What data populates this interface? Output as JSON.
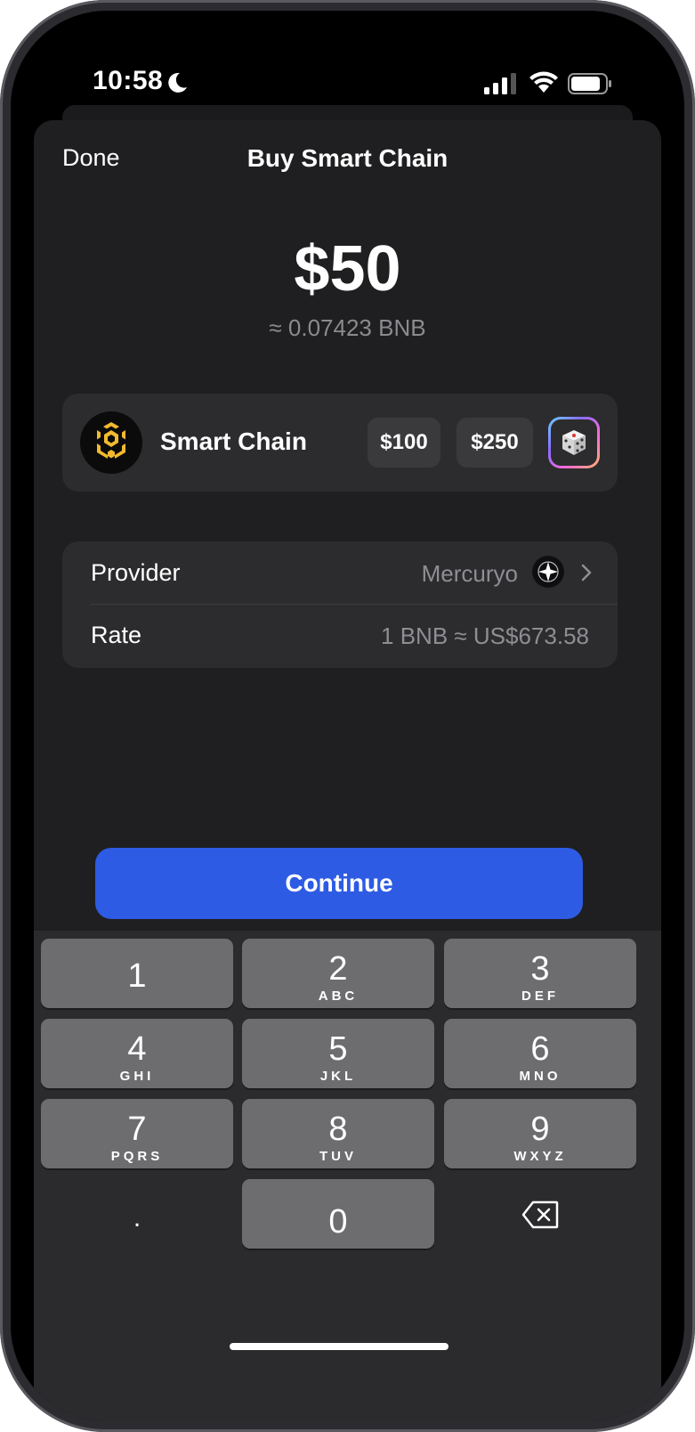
{
  "status_bar": {
    "time": "10:58"
  },
  "sheet": {
    "done_label": "Done",
    "title": "Buy Smart Chain"
  },
  "amount": {
    "value": "$50",
    "converted": "≈ 0.07423 BNB"
  },
  "asset": {
    "name": "Smart Chain",
    "logo_color": "#F3BA2F",
    "presets": [
      "$100",
      "$250"
    ],
    "random_icon": "dice-icon"
  },
  "details": {
    "provider_label": "Provider",
    "provider_value": "Mercuryo",
    "rate_label": "Rate",
    "rate_value": "1 BNB ≈ US$673.58"
  },
  "continue_label": "Continue",
  "accent_color": "#2D5BE3",
  "keypad": {
    "keys": [
      {
        "digit": "1",
        "letters": ""
      },
      {
        "digit": "2",
        "letters": "ABC"
      },
      {
        "digit": "3",
        "letters": "DEF"
      },
      {
        "digit": "4",
        "letters": "GHI"
      },
      {
        "digit": "5",
        "letters": "JKL"
      },
      {
        "digit": "6",
        "letters": "MNO"
      },
      {
        "digit": "7",
        "letters": "PQRS"
      },
      {
        "digit": "8",
        "letters": "TUV"
      },
      {
        "digit": "9",
        "letters": "WXYZ"
      },
      {
        "digit": "0",
        "letters": ""
      }
    ],
    "decimal": ".",
    "delete_icon": "backspace-icon"
  }
}
